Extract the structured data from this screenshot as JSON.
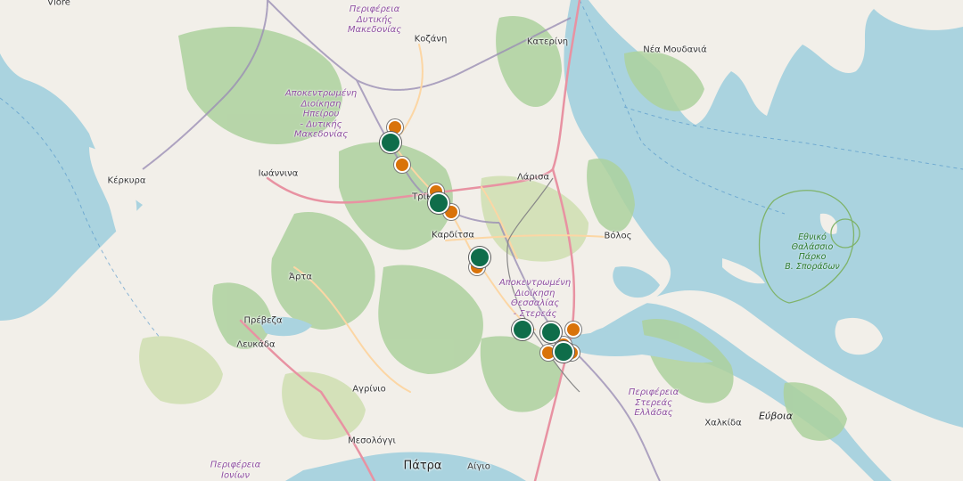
{
  "map": {
    "colors": {
      "sea": "#aad3df",
      "land": "#f2efe9",
      "forest": "#add19e",
      "green_area": "#c8dca4",
      "motorway": "#e892a2",
      "primary_road": "#fcd6a4",
      "admin_border": "#9b8fb5",
      "park_border": "#7fb36a",
      "marker_orange": "#d9730a",
      "marker_green": "#0f6d4a"
    },
    "cities": [
      {
        "id": "vlore",
        "name": "Vlorë"
      },
      {
        "id": "kozani",
        "name": "Κοζάνη"
      },
      {
        "id": "katerini",
        "name": "Κατερίνη"
      },
      {
        "id": "nea-moudania",
        "name": "Νέα Μουδανιά"
      },
      {
        "id": "ioannina",
        "name": "Ιωάννινα"
      },
      {
        "id": "kerkyra",
        "name": "Κέρκυρα"
      },
      {
        "id": "larisa",
        "name": "Λάρισα"
      },
      {
        "id": "trikala",
        "name": "Τρίκ"
      },
      {
        "id": "karditsa",
        "name": "Καρδίτσα"
      },
      {
        "id": "volos",
        "name": "Βόλος"
      },
      {
        "id": "arta",
        "name": "Άρτα"
      },
      {
        "id": "preveza",
        "name": "Πρέβεζα"
      },
      {
        "id": "lefkada",
        "name": "Λευκάδα"
      },
      {
        "id": "agrinio",
        "name": "Αγρίνιο"
      },
      {
        "id": "chalkida",
        "name": "Χαλκίδα"
      },
      {
        "id": "mesologgi",
        "name": "Μεσολόγγι"
      },
      {
        "id": "aigio",
        "name": "Αίγιο"
      }
    ],
    "major_cities": [
      {
        "id": "patra",
        "name": "Πάτρα"
      }
    ],
    "islands": [
      {
        "id": "evia",
        "name": "Εύβοια"
      }
    ],
    "admin_regions": [
      {
        "id": "west-macedonia",
        "lines": [
          "Περιφέρεια",
          "Δυτικής",
          "Μακεδονίας"
        ]
      },
      {
        "id": "epirus-west-macedonia",
        "lines": [
          "Αποκεντρωμένη",
          "Διοίκηση",
          "Ηπείρου",
          "- Δυτικής",
          "Μακεδονίας"
        ]
      },
      {
        "id": "thessaly-central-greece",
        "lines": [
          "Αποκεντρωμένη",
          "Διοίκηση",
          "Θεσσαλίας",
          "- Στερεάς"
        ]
      },
      {
        "id": "central-greece",
        "lines": [
          "Περιφέρεια",
          "Στερεάς",
          "Ελλάδας"
        ]
      },
      {
        "id": "ionian",
        "lines": [
          "Περιφέρεια",
          "Ιονίων"
        ]
      }
    ],
    "parks": [
      {
        "id": "sporades-park",
        "lines": [
          "Εθνικό",
          "Θαλάσσιο",
          "Πάρκο",
          "Β. Σποράδων"
        ]
      }
    ],
    "markers_orange": [
      "marker-1",
      "marker-2",
      "marker-3",
      "marker-4",
      "marker-5",
      "marker-6",
      "marker-7",
      "marker-8",
      "marker-9"
    ],
    "markers_green": [
      "marker-1",
      "marker-2",
      "marker-3",
      "marker-4",
      "marker-5",
      "marker-6"
    ]
  }
}
